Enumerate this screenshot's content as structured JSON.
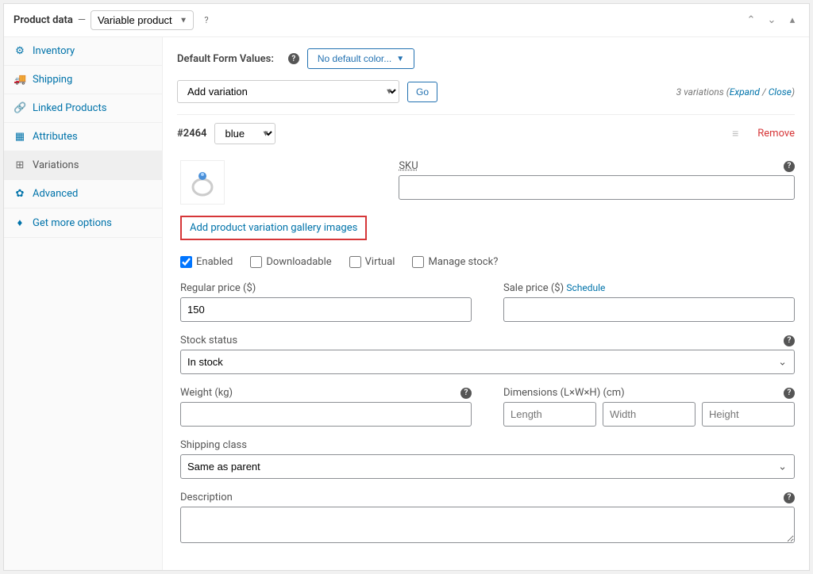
{
  "header": {
    "title": "Product data",
    "sep": "—",
    "product_type": "Variable product"
  },
  "sidebar": {
    "items": [
      {
        "icon": "inventory",
        "label": "Inventory",
        "active": false
      },
      {
        "icon": "shipping",
        "label": "Shipping",
        "active": false
      },
      {
        "icon": "linked",
        "label": "Linked Products",
        "active": false
      },
      {
        "icon": "attributes",
        "label": "Attributes",
        "active": false
      },
      {
        "icon": "variations",
        "label": "Variations",
        "active": true
      },
      {
        "icon": "advanced",
        "label": "Advanced",
        "active": false
      },
      {
        "icon": "more",
        "label": "Get more options",
        "active": false
      }
    ]
  },
  "form": {
    "default_label": "Default Form Values:",
    "default_value": "No default color...",
    "add_variation": "Add variation",
    "go": "Go",
    "var_count_text": "3 variations",
    "expand": "Expand",
    "close": "Close"
  },
  "variation": {
    "id": "#2464",
    "attr": "blue",
    "remove": "Remove",
    "sku_label": "SKU",
    "sku_value": "",
    "gallery_link": "Add product variation gallery images",
    "checks": {
      "enabled": "Enabled",
      "downloadable": "Downloadable",
      "virtual": "Virtual",
      "manage_stock": "Manage stock?"
    },
    "regular_price_label": "Regular price ($)",
    "regular_price_value": "150",
    "sale_price_label": "Sale price ($)",
    "sale_price_value": "",
    "schedule": "Schedule",
    "stock_status_label": "Stock status",
    "stock_status_value": "In stock",
    "weight_label": "Weight (kg)",
    "weight_value": "",
    "dims_label": "Dimensions (L×W×H) (cm)",
    "dims": {
      "length_ph": "Length",
      "width_ph": "Width",
      "height_ph": "Height"
    },
    "shipping_class_label": "Shipping class",
    "shipping_class_value": "Same as parent",
    "description_label": "Description",
    "description_value": ""
  }
}
